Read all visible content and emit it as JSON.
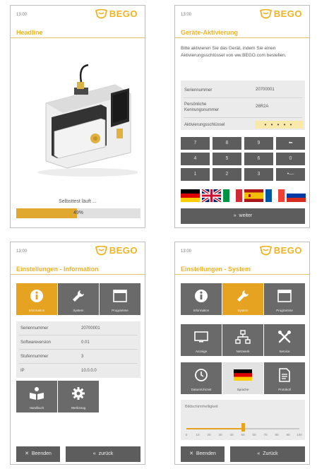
{
  "screens": [
    {
      "time": "13:00",
      "brand": "BEGO",
      "title": "Headline",
      "status": "Selbsttest läuft ...",
      "progress": 0.49,
      "progress_label": "49%"
    },
    {
      "time": "13:00",
      "brand": "BEGO",
      "title": "Geräte-Aktivierung",
      "intro": "Bitte aktivieren Sie das Gerät, indem Sie einen Aktivierungsschlüssel von ww.BEGO.com bestellen.",
      "rows": [
        {
          "key": "Seriennummer",
          "value": "20700001"
        },
        {
          "key": "Persönliche Kennungsnummer",
          "value": "26R2A"
        },
        {
          "key": "Aktivierungsschlüssel",
          "value": "• • • • •"
        }
      ],
      "keypad": [
        "7",
        "8",
        "9",
        "⬅",
        "4",
        "5",
        "6",
        "0",
        "1",
        "2",
        "3",
        "•—"
      ],
      "flags": [
        "de",
        "gb",
        "it",
        "es",
        "fr",
        "ru"
      ],
      "weiter": "weiter",
      "weiter_icon": "»"
    },
    {
      "time": "13:00",
      "brand": "BEGO",
      "title": "Einstellungen - Information",
      "tiles": [
        {
          "label": "Information",
          "icon": "info-icon",
          "active": true
        },
        {
          "label": "System",
          "icon": "wrench-icon",
          "active": false
        },
        {
          "label": "Programme",
          "icon": "window-icon",
          "active": false
        }
      ],
      "rows": [
        {
          "key": "Seriennummer",
          "value": "20700001"
        },
        {
          "key": "Softwareversion",
          "value": "0.01"
        },
        {
          "key": "Stufennummer",
          "value": "3"
        },
        {
          "key": "IP",
          "value": "10.0.0.0"
        }
      ],
      "tiles2": [
        {
          "label": "Handbuch",
          "icon": "book-icon",
          "active": false
        },
        {
          "label": "Werkzeug",
          "icon": "gear-icon",
          "active": false
        }
      ],
      "beenden": "Beenden",
      "zuruck": "zurück"
    },
    {
      "time": "13:00",
      "brand": "BEGO",
      "title": "Einstellungen - System",
      "tiles": [
        {
          "label": "Information",
          "icon": "info-icon",
          "active": false
        },
        {
          "label": "System",
          "icon": "wrench-icon",
          "active": true
        },
        {
          "label": "Programme",
          "icon": "window-icon",
          "active": false
        },
        {
          "label": "Anzeige",
          "icon": "monitor-icon",
          "active": false
        },
        {
          "label": "Netzwerk",
          "icon": "network-icon",
          "active": false
        },
        {
          "label": "Service",
          "icon": "tools-icon",
          "active": false
        },
        {
          "label": "Datum/Uhrzeit",
          "icon": "clock-icon",
          "active": false
        },
        {
          "label": "Sprache",
          "icon": "german-flag-icon",
          "active": false
        },
        {
          "label": "Protokoll",
          "icon": "document-icon",
          "active": false
        }
      ],
      "slider_title": "Bildschirmhelligkeit",
      "slider_value": 0.5,
      "slider_ticks": [
        "0",
        "10",
        "20",
        "30",
        "40",
        "50",
        "60",
        "70",
        "80",
        "90",
        "100"
      ],
      "beenden": "Beenden",
      "zuruck": "Zurück"
    }
  ],
  "colors": {
    "accent": "#f0b323",
    "tile": "#6a6a6a",
    "active_tile": "#e6a321",
    "button": "#5d5d5d"
  }
}
